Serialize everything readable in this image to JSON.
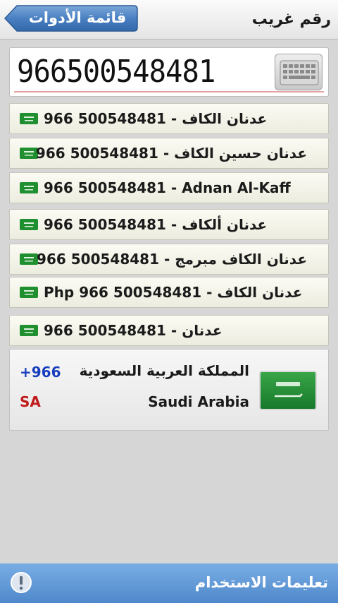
{
  "header": {
    "title": "رقم غريب",
    "back_label": "قائمة الأدوات",
    "accent": "#3e77bd"
  },
  "number_input": {
    "value": "966500548481",
    "keyboard_icon": "keyboard-icon"
  },
  "contacts": [
    {
      "text": "عدنان الكاف - 500548481 966",
      "flag_icon": "saudi-flag-icon"
    },
    {
      "text": "عدنان حسين الكاف - 500548481 966",
      "flag_icon": "saudi-flag-icon"
    },
    {
      "text": "966 500548481 - Adnan Al-Kaff",
      "flag_icon": "saudi-flag-icon"
    },
    {
      "text": "عدنان ألكاف - 500548481 966",
      "flag_icon": "saudi-flag-icon"
    },
    {
      "text": "عدنان الكاف مبرمج - 500548481 966",
      "flag_icon": "saudi-flag-icon"
    },
    {
      "text": "Php عدنان الكاف - 500548481 966",
      "flag_icon": "saudi-flag-icon"
    },
    {
      "text": "عدنان - 500548481 966",
      "flag_icon": "saudi-flag-icon"
    }
  ],
  "country": {
    "name_ar": "المملكة العربية السعودية",
    "name_en": "Saudi Arabia",
    "code": "+966",
    "iso": "SA",
    "code_color": "#1a3fbd",
    "iso_color": "#c01a1a"
  },
  "footer": {
    "label": "تعليمات الاستخدام",
    "help_icon": "info-icon",
    "color": "#5b93d3"
  }
}
